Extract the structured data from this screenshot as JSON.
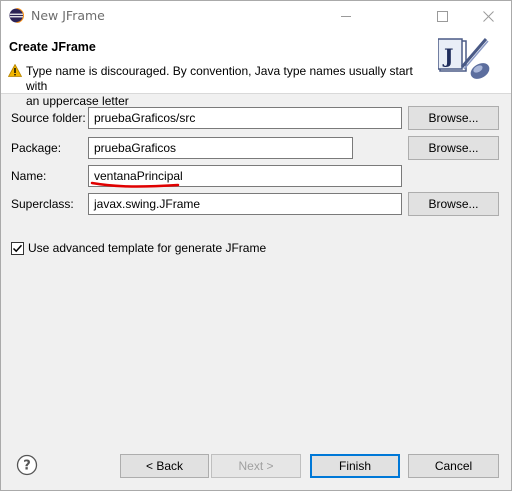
{
  "window": {
    "title": "New JFrame",
    "minimize_icon": "minimize-icon",
    "maximize_icon": "maximize-icon",
    "close_icon": "close-icon"
  },
  "header": {
    "title": "Create JFrame",
    "warning_line1": "Type name is discouraged. By convention, Java type names usually start with",
    "warning_line2": "an uppercase letter",
    "warning_icon": "warning-icon",
    "wizard_icon": "jframe-wizard-icon"
  },
  "form": {
    "source_folder": {
      "label": "Source folder:",
      "value": "pruebaGraficos/src",
      "button": "Browse..."
    },
    "package": {
      "label": "Package:",
      "value": "pruebaGraficos",
      "button": "Browse..."
    },
    "name": {
      "label": "Name:",
      "value": "ventanaPrincipal"
    },
    "superclass": {
      "label": "Superclass:",
      "value": "javax.swing.JFrame",
      "button": "Browse..."
    },
    "advanced_template": {
      "label": "Use advanced template for generate JFrame",
      "checked": true
    }
  },
  "footer": {
    "help_icon": "help-icon",
    "back": "< Back",
    "next": "Next >",
    "finish": "Finish",
    "cancel": "Cancel"
  },
  "colors": {
    "accent": "#0078d7",
    "annotation": "#e00000",
    "warning": "#f2b600"
  }
}
